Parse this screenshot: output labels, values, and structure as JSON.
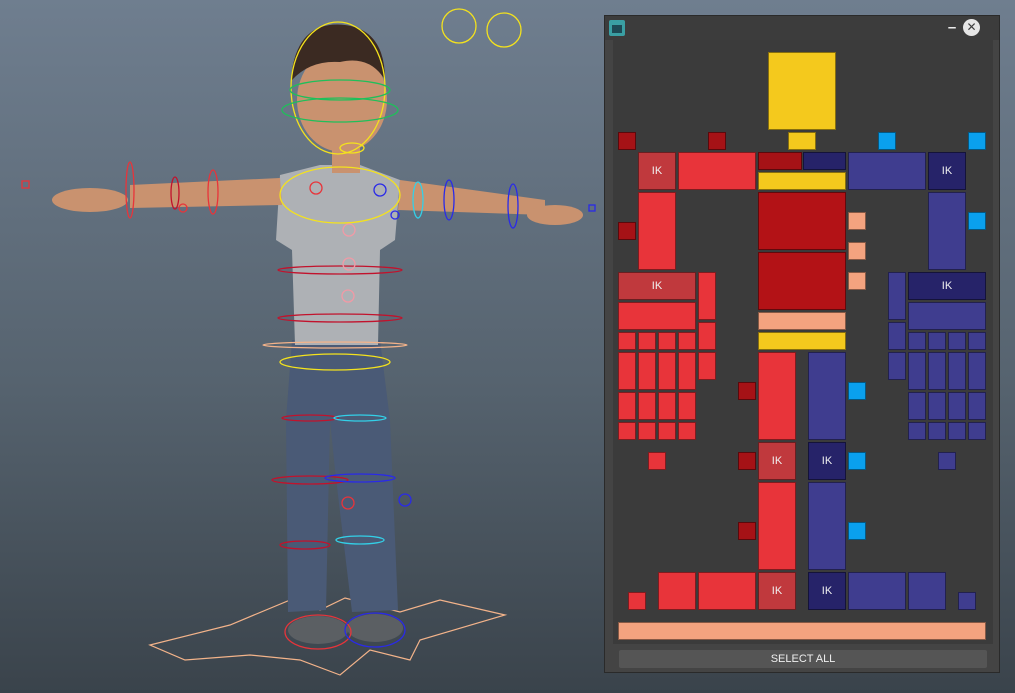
{
  "window": {
    "minimize_label": "–",
    "close_label": "✕"
  },
  "picker": {
    "ik_label": "IK",
    "select_all_label": "SELECT ALL"
  },
  "colors": {
    "viewport_bg_top": "#6f7e8f",
    "viewport_bg_bottom": "#3a434b",
    "panel_bg": "#444444",
    "left_side_red": "#e8343a",
    "right_side_blue": "#3f3d8f",
    "center_yellow": "#f4c91d",
    "fk_cyan": "#0aa0ee",
    "peach": "#f4a37f"
  }
}
